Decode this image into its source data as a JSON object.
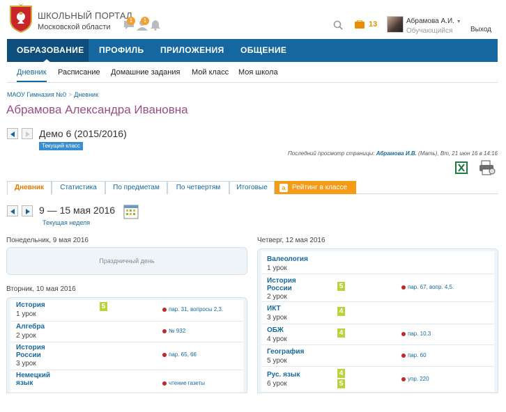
{
  "header": {
    "portal_title": "Школьный портал",
    "portal_region": "Московской области",
    "badge_messages": "1",
    "badge_friends": "1",
    "portfolio_count": "13",
    "user_name": "Абрамова А.И.",
    "user_role": "Обучающийся",
    "logout": "Выход"
  },
  "mainnav": [
    "ОБРАЗОВАНИЕ",
    "ПРОФИЛЬ",
    "ПРИЛОЖЕНИЯ",
    "ОБЩЕНИЕ"
  ],
  "subnav": [
    "Дневник",
    "Расписание",
    "Домашние задания",
    "Мой класс",
    "Моя школа"
  ],
  "breadcrumb": {
    "school": "МАОУ Гимназия №0",
    "sep": ">",
    "page": "Дневник"
  },
  "student_name": "Абрамова Александра Ивановна",
  "period": {
    "title": "Демо 6 (2015/2016)",
    "current": "Текущий класс"
  },
  "last_view": {
    "prefix": "Последний просмотр страницы:",
    "who": "Абрамова И.В.",
    "suffix": "(Мать), Вт, 21 июн 16 в 14:16"
  },
  "tabs": [
    "Дневник",
    "Статистика",
    "По предметам",
    "По четвертям",
    "Итоговые",
    "Рейтинг в классе"
  ],
  "rating_badge": "a",
  "week": {
    "range": "9 — 15 мая 2016",
    "current": "Текущая неделя"
  },
  "days": {
    "mon": {
      "title": "Понедельник, 9 мая 2016",
      "holiday": "Праздничный день"
    },
    "tue": {
      "title": "Вторник, 10 мая 2016",
      "lessons": [
        {
          "subject": "История",
          "num": "1 урок",
          "marks": [
            "5"
          ],
          "hw": "пар. 31, вопросы 2,3."
        },
        {
          "subject": "Алгебра",
          "num": "2 урок",
          "marks": [],
          "hw": "№ 932"
        },
        {
          "subject": "История России",
          "num": "3 урок",
          "marks": [],
          "hw": "пар. 65, 66"
        },
        {
          "subject": "Немецкий язык",
          "num": "",
          "marks": [],
          "hw": "чтение газеты"
        }
      ]
    },
    "thu": {
      "title": "Четверг, 12 мая 2016",
      "lessons": [
        {
          "subject": "Валеология",
          "num": "1 урок",
          "marks": [],
          "hw": ""
        },
        {
          "subject": "История России",
          "num": "2 урок",
          "marks": [
            "5"
          ],
          "hw": "пар. 67, вопр. 4,5."
        },
        {
          "subject": "ИКТ",
          "num": "3 урок",
          "marks": [
            "4"
          ],
          "hw": ""
        },
        {
          "subject": "ОБЖ",
          "num": "4 урок",
          "marks": [
            "4"
          ],
          "hw": "пар. 10.3"
        },
        {
          "subject": "География",
          "num": "5 урок",
          "marks": [],
          "hw": "пар. 60"
        },
        {
          "subject": "Рус. язык",
          "num": "6 урок",
          "marks": [
            "4",
            "5"
          ],
          "hw": "упр. 220"
        }
      ]
    }
  },
  "colors": {
    "brand": "#15689f",
    "name": "#9b4d86",
    "orange": "#f49c18",
    "mark": "#b9d33a"
  }
}
